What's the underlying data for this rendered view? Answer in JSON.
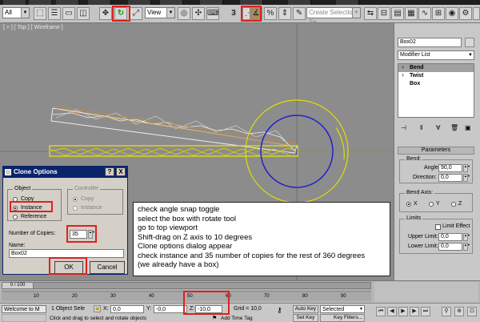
{
  "toolbar": {
    "selection_filter": "All",
    "reference_coordinate": "View",
    "snap_number": "3",
    "named_selection_placeholder": "Create Selection Se",
    "highlighted_tools": [
      "select-and-rotate",
      "angle-snap-toggle"
    ]
  },
  "viewport": {
    "label": "[ + ] [ Top ] [ Wireframe ]"
  },
  "command_panel": {
    "object_name": "Box02",
    "modifier_list": "Modifier List",
    "stack": [
      "Bend",
      "Twist",
      "Box"
    ],
    "parameters_title": "Parameters",
    "bend_group": "Bend:",
    "angle_label": "Angle:",
    "angle_value": "90,0",
    "direction_label": "Direction:",
    "direction_value": "0,0",
    "axis_group": "Bend Axis:",
    "axes": [
      "X",
      "Y",
      "Z"
    ],
    "selected_axis": "X",
    "limits_group": "Limits",
    "limit_effect": "Limit Effect",
    "upper_label": "Upper Limit:",
    "upper_value": "0,0",
    "lower_label": "Lower Limit:",
    "lower_value": "0,0"
  },
  "dialog": {
    "title": "Clone Options",
    "help": "?",
    "close": "X",
    "object_group": "Object",
    "object_options": [
      "Copy",
      "Instance",
      "Reference"
    ],
    "selected_object": "Instance",
    "controller_group": "Controller",
    "controller_options": [
      "Copy",
      "Instance"
    ],
    "copies_label": "Number of Copies:",
    "copies_value": "35",
    "name_label": "Name:",
    "name_value": "Box02",
    "ok": "OK",
    "cancel": "Cancel"
  },
  "notes": [
    "check angle snap toggle",
    "select the box with rotate tool",
    "go to top viewport",
    "Shift-drag on Z axis to 10 degrees",
    "Clone options dialog appear",
    "check instance and 35 number of copies for the rest of 360 degrees",
    "(we already have a box)"
  ],
  "timeline": {
    "frame_display": "0 / 100",
    "ticks": [
      "10",
      "20",
      "30",
      "40",
      "50",
      "60",
      "70",
      "80",
      "90"
    ]
  },
  "status": {
    "script_listener": "Welcome to M",
    "selection_info": "1 Object Sele",
    "prompt": "Click and drag to select and rotate objects",
    "x_label": "X:",
    "x_value": "0,0",
    "y_label": "Y:",
    "y_value": "-0,0",
    "z_label": "Z:",
    "z_value": "-10,0",
    "grid": "Grid = 10,0",
    "add_time_tag": "Add Time Tag",
    "auto_key": "Auto Key",
    "set_key": "Set Key",
    "key_mode": "Selected",
    "key_filters": "Key Filters..."
  },
  "colors": {
    "highlight": "#e0201c",
    "dialog_title": "#0a246a",
    "gizmo_outer": "#e0e000",
    "gizmo_inner": "#2222cc"
  }
}
